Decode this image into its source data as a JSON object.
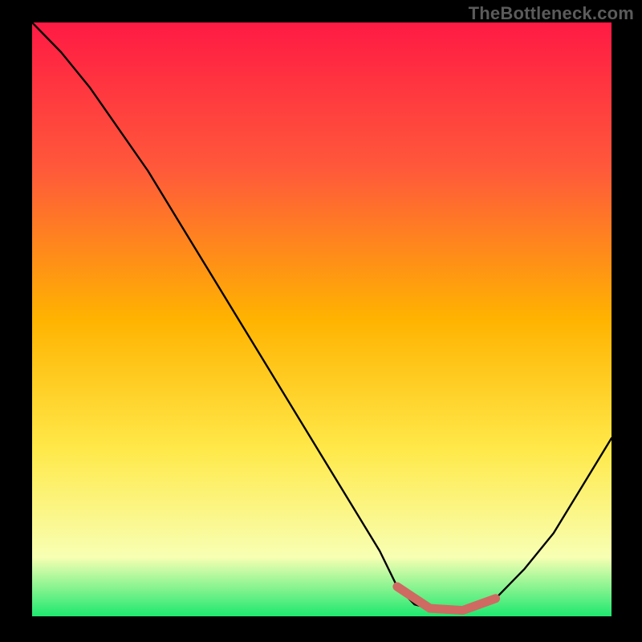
{
  "watermark": "TheBottleneck.com",
  "colors": {
    "black": "#000000",
    "watermark": "#5b5b5b",
    "curve": "#000000",
    "marker": "#cf6a62",
    "grad_top": "#ff1a44",
    "grad_mid1": "#ff5a3a",
    "grad_mid2": "#ffb300",
    "grad_mid3": "#ffe94a",
    "grad_bottom_yellow": "#f8ffb3",
    "grad_green": "#1ee86f"
  },
  "chart_data": {
    "type": "line",
    "title": "",
    "xlabel": "",
    "ylabel": "",
    "xlim": [
      0,
      100
    ],
    "ylim": [
      0,
      100
    ],
    "series": [
      {
        "name": "bottleneck-curve",
        "x": [
          0,
          5,
          10,
          15,
          20,
          25,
          30,
          35,
          40,
          45,
          50,
          55,
          60,
          63,
          66,
          70,
          75,
          80,
          85,
          90,
          95,
          100
        ],
        "values": [
          100,
          95,
          89,
          82,
          75,
          67,
          59,
          51,
          43,
          35,
          27,
          19,
          11,
          5,
          2,
          1,
          1,
          3,
          8,
          14,
          22,
          30
        ]
      }
    ],
    "highlight": {
      "name": "optimal-range",
      "x_start": 63,
      "x_end": 80,
      "y": 1
    },
    "annotations": []
  }
}
